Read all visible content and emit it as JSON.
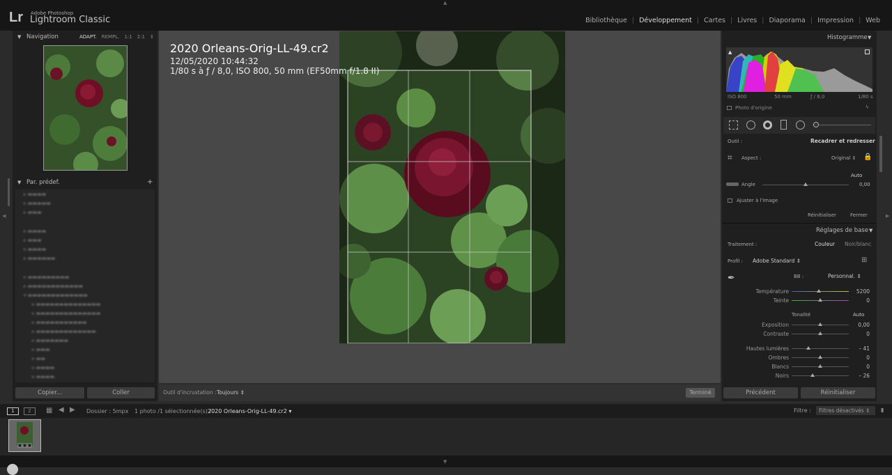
{
  "app": {
    "logo": "Lr",
    "brand_small": "Adobe Photoshop",
    "brand_big": "Lightroom Classic"
  },
  "modules": [
    {
      "label": "Bibliothèque"
    },
    {
      "label": "Développement",
      "active": true
    },
    {
      "label": "Cartes"
    },
    {
      "label": "Livres"
    },
    {
      "label": "Diaporama"
    },
    {
      "label": "Impression"
    },
    {
      "label": "Web"
    }
  ],
  "navigator": {
    "title": "Navigation",
    "zoom": [
      "ADAPT.",
      "REMPL.",
      "1:1",
      "2:1"
    ]
  },
  "presets": {
    "title": "Par. prédef.",
    "add": "+"
  },
  "left_buttons": {
    "copy": "Copier...",
    "paste": "Coller"
  },
  "photo_info": {
    "name": "2020 Orleans-Orig-LL-49.cr2",
    "date": "12/05/2020 10:44:32",
    "exif": "1/80 s à ƒ / 8,0, ISO 800, 50 mm (EF50mm f/1.8 II)"
  },
  "toolbar": {
    "overlay_label": "Outil d'incrustation :",
    "overlay_value": "Toujours",
    "done": "Terminé"
  },
  "histogram": {
    "title": "Histogramme",
    "iso": "ISO 800",
    "focal": "50 mm",
    "aperture": "ƒ / 8,0",
    "shutter": "1/80 s",
    "original": "Photo d'origine"
  },
  "crop": {
    "tool_label": "Outil :",
    "tool_name": "Recadrer et redresser",
    "aspect_label": "Aspect :",
    "aspect_value": "Original",
    "auto": "Auto",
    "angle_label": "Angle",
    "angle_value": "0,00",
    "constrain": "Ajuster à l'image",
    "reset": "Réinitialiser",
    "close": "Fermer"
  },
  "basic": {
    "title": "Réglages de base",
    "treatment_label": "Traitement :",
    "color": "Couleur",
    "bw": "Noir/blanc",
    "profile_label": "Profil :",
    "profile_value": "Adobe Standard",
    "wb_label": "BB :",
    "wb_value": "Personnal.",
    "tone": "Tonalité",
    "tone_auto": "Auto",
    "sliders": [
      {
        "label": "Température",
        "value": "5200",
        "pos": 0.47
      },
      {
        "label": "Teinte",
        "value": "0",
        "pos": 0.5
      },
      {
        "label": "Exposition",
        "value": "0,00",
        "pos": 0.5
      },
      {
        "label": "Contraste",
        "value": "0",
        "pos": 0.5
      },
      {
        "label": "Hautes lumières",
        "value": "– 41",
        "pos": 0.29
      },
      {
        "label": "Ombres",
        "value": "0",
        "pos": 0.5
      },
      {
        "label": "Blancs",
        "value": "0",
        "pos": 0.5
      },
      {
        "label": "Noirs",
        "value": "– 26",
        "pos": 0.37
      }
    ]
  },
  "right_buttons": {
    "prev": "Précédent",
    "reset": "Réinitialiser"
  },
  "filmstrip_bar": {
    "page1": "1",
    "page2": "2",
    "folder": "Dossier : 5mpx",
    "selection": "1 photo /1 sélectionnée(s) /",
    "file": "2020 Orleans-Orig-LL-49.cr2",
    "filter_label": "Filtre :",
    "filter_value": "Filtres désactivés"
  }
}
